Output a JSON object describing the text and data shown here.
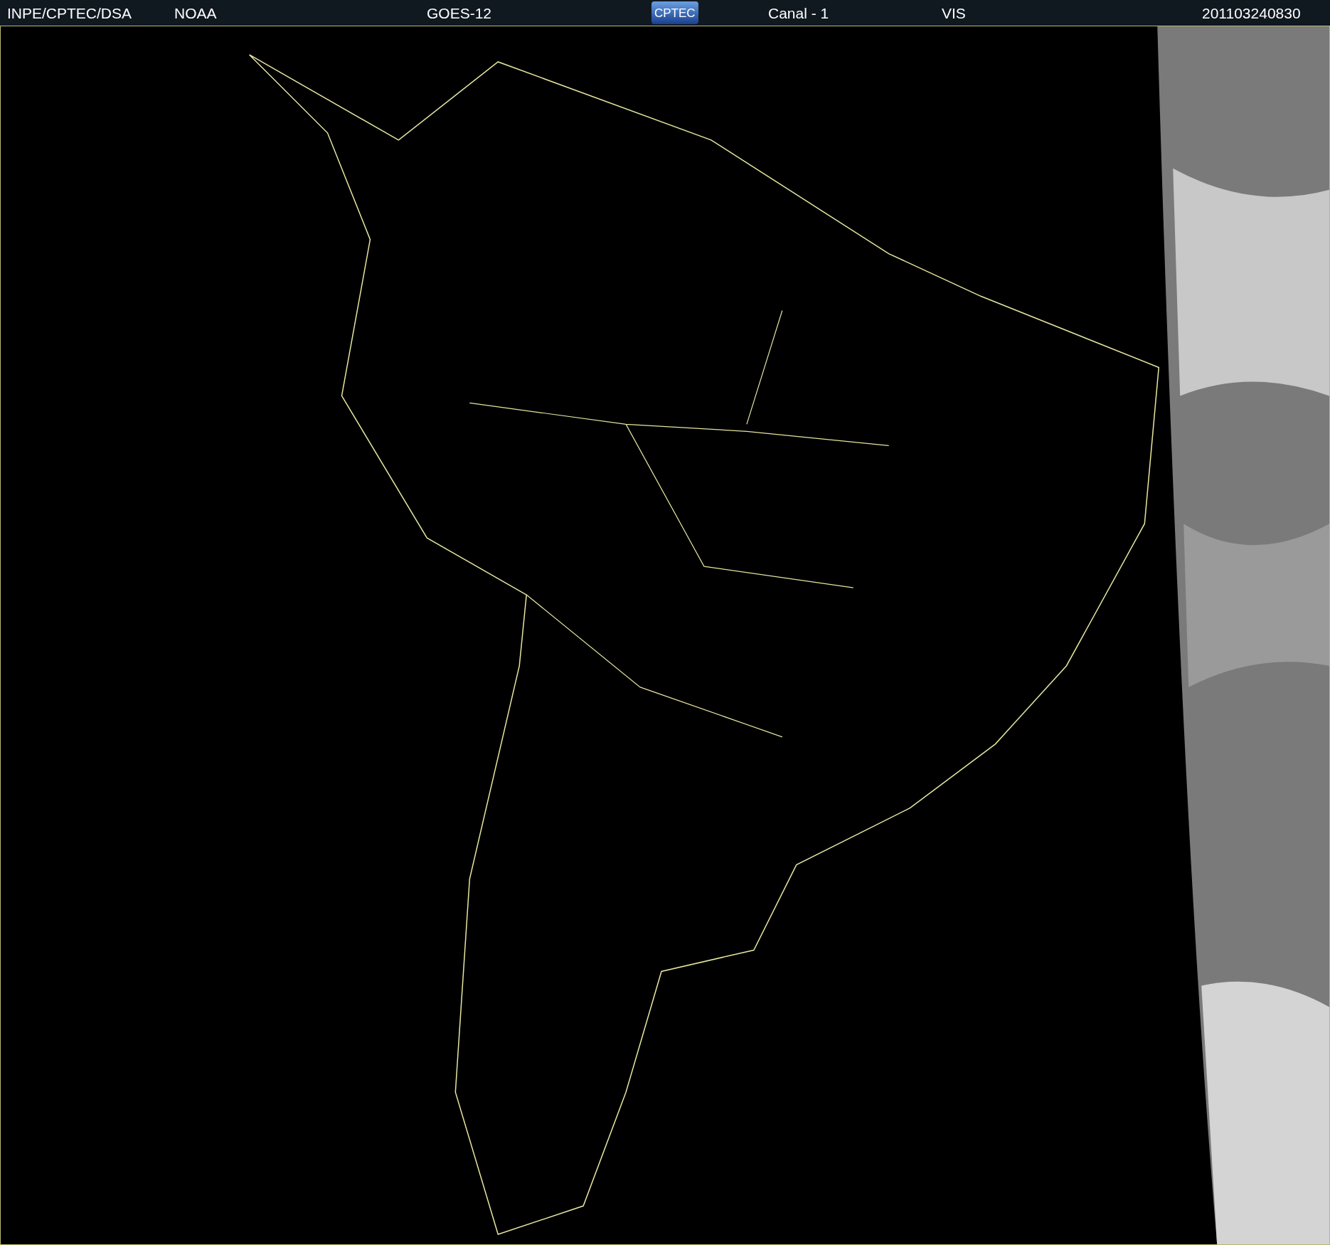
{
  "header": {
    "items": [
      {
        "kind": "text",
        "text": "INPE/CPTEC/DSA"
      },
      {
        "kind": "text",
        "text": "NOAA"
      },
      {
        "kind": "text",
        "text": "GOES-12"
      },
      {
        "kind": "logo",
        "text": "CPTEC"
      },
      {
        "kind": "text",
        "text": "Canal - 1"
      },
      {
        "kind": "text",
        "text": "VIS"
      },
      {
        "kind": "text",
        "text": "201103240830"
      }
    ]
  }
}
